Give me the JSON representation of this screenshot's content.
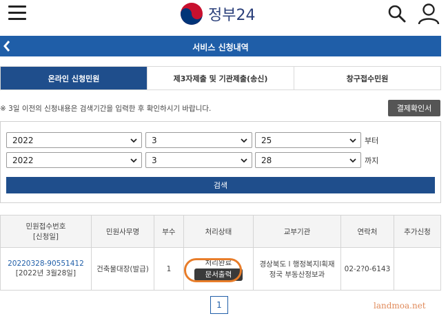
{
  "header": {
    "logo_text": "정부24",
    "menu_icon": "hamburger-icon",
    "search_icon": "search-icon",
    "user_icon": "user-icon"
  },
  "titlebar": {
    "title": "서비스 신청내역",
    "back_icon": "chevron-left-icon",
    "color": "#1f5ea8"
  },
  "tabs": [
    {
      "label": "온라인 신청민원",
      "active": true
    },
    {
      "label": "제3자제출 및 기관제출(송신)",
      "active": false
    },
    {
      "label": "창구접수민원",
      "active": false
    }
  ],
  "notice": "※ 3일 이전의 신청내용은 검색기간을 입력한 후 확인하시기 바랍니다.",
  "receipt_button": "결제확인서",
  "search": {
    "from": {
      "year": "2022",
      "month": "3",
      "day": "25",
      "label": "부터"
    },
    "to": {
      "year": "2022",
      "month": "3",
      "day": "28",
      "label": "까지"
    },
    "button": "검색"
  },
  "table": {
    "headers": {
      "receipt_no": "민원접수번호",
      "receipt_date": "[신청일]",
      "name": "민원사무명",
      "copies": "부수",
      "status": "처리상태",
      "agency": "교부기관",
      "contact": "연락처",
      "extra": "추가신청"
    },
    "rows": [
      {
        "receipt_no": "20220328-90551412",
        "receipt_date": "[2022년 3월28일]",
        "name": "건축물대장(발급)",
        "copies": "1",
        "status": "처리완료",
        "print_button": "문서출력",
        "agency_line1": "경상북도 l 행정복지l획재",
        "agency_line2": "정국 부동산정보과",
        "contact": "02-2?0-6143",
        "extra": ""
      }
    ]
  },
  "pagination": {
    "current": "1"
  },
  "watermark": "landmoa.net",
  "accent_colors": {
    "primary": "#1f4e8c",
    "highlight": "#e87d2a"
  }
}
